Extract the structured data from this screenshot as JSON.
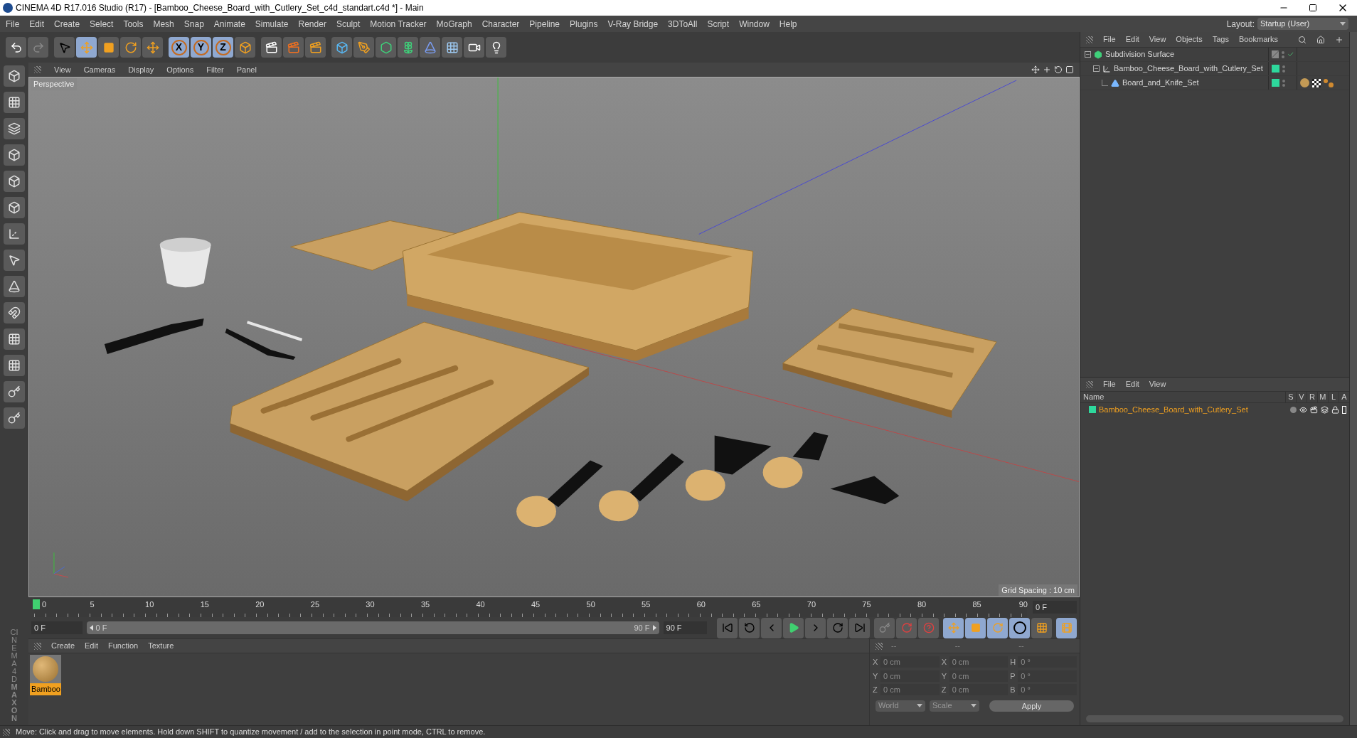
{
  "window": {
    "title": "CINEMA 4D R17.016 Studio (R17) - [Bamboo_Cheese_Board_with_Cutlery_Set_c4d_standart.c4d *] - Main"
  },
  "menu": [
    "File",
    "Edit",
    "Create",
    "Select",
    "Tools",
    "Mesh",
    "Snap",
    "Animate",
    "Simulate",
    "Render",
    "Sculpt",
    "Motion Tracker",
    "MoGraph",
    "Character",
    "Pipeline",
    "Plugins",
    "V-Ray Bridge",
    "3DToAll",
    "Script",
    "Window",
    "Help"
  ],
  "layout": {
    "label": "Layout:",
    "value": "Startup (User)"
  },
  "toolbar": {
    "axes": [
      {
        "label": "X",
        "selected": true
      },
      {
        "label": "Y",
        "selected": true
      },
      {
        "label": "Z",
        "selected": true
      }
    ]
  },
  "viewport": {
    "menu": [
      "View",
      "Cameras",
      "Display",
      "Options",
      "Filter",
      "Panel"
    ],
    "camera": "Perspective",
    "grid_spacing": "Grid Spacing : 10 cm"
  },
  "timeline": {
    "ticks": [
      "0",
      "5",
      "10",
      "15",
      "20",
      "25",
      "30",
      "35",
      "40",
      "45",
      "50",
      "55",
      "60",
      "65",
      "70",
      "75",
      "80",
      "85",
      "90"
    ],
    "level": 0,
    "current_frame": "0 F",
    "start_field": "0 F",
    "range": {
      "start": "0 F",
      "end": "90 F",
      "level": 1
    },
    "end_field": "90 F"
  },
  "object_manager": {
    "menu": [
      "File",
      "Edit",
      "View",
      "Objects",
      "Tags",
      "Bookmarks"
    ],
    "objects": [
      {
        "name": "Subdivision Surface",
        "kind": "generator",
        "layer": false,
        "enabled": true,
        "children": [
          {
            "name": "Bamboo_Cheese_Board_with_Cutlery_Set",
            "kind": "null",
            "layer": true,
            "enabled": false,
            "children": [
              {
                "name": "Board_and_Knife_Set",
                "kind": "polygon",
                "layer": true,
                "enabled": false
              }
            ]
          }
        ]
      }
    ]
  },
  "layer_manager": {
    "menu": [
      "File",
      "Edit",
      "View"
    ],
    "columns": [
      "Name",
      "S",
      "V",
      "R",
      "M",
      "L",
      "A"
    ],
    "rows": [
      {
        "name": "Bamboo_Cheese_Board_with_Cutlery_Set"
      }
    ]
  },
  "material_manager": {
    "menu": [
      "Create",
      "Edit",
      "Function",
      "Texture"
    ],
    "materials": [
      {
        "name": "Bamboo",
        "selected": true
      }
    ]
  },
  "brand": {
    "company": "MAXON",
    "product": "CINEMA 4D"
  },
  "coordinates": {
    "disabled": true,
    "columns": [
      {
        "header": "--",
        "rows": [
          {
            "axis": "X",
            "value": "0 cm"
          },
          {
            "axis": "Y",
            "value": "0 cm"
          },
          {
            "axis": "Z",
            "value": "0 cm"
          }
        ]
      },
      {
        "header": "--",
        "rows": [
          {
            "axis": "X",
            "value": "0 cm"
          },
          {
            "axis": "Y",
            "value": "0 cm"
          },
          {
            "axis": "Z",
            "value": "0 cm"
          }
        ]
      },
      {
        "header": "--",
        "rows": [
          {
            "axis": "H",
            "value": "0 °"
          },
          {
            "axis": "P",
            "value": "0 °"
          },
          {
            "axis": "B",
            "value": "0 °"
          }
        ]
      }
    ],
    "dropdowns": [
      "World",
      "Scale"
    ],
    "apply": "Apply"
  },
  "status_bar": "Move: Click and drag to move elements. Hold down SHIFT to quantize movement / add to the selection in point mode, CTRL to remove."
}
